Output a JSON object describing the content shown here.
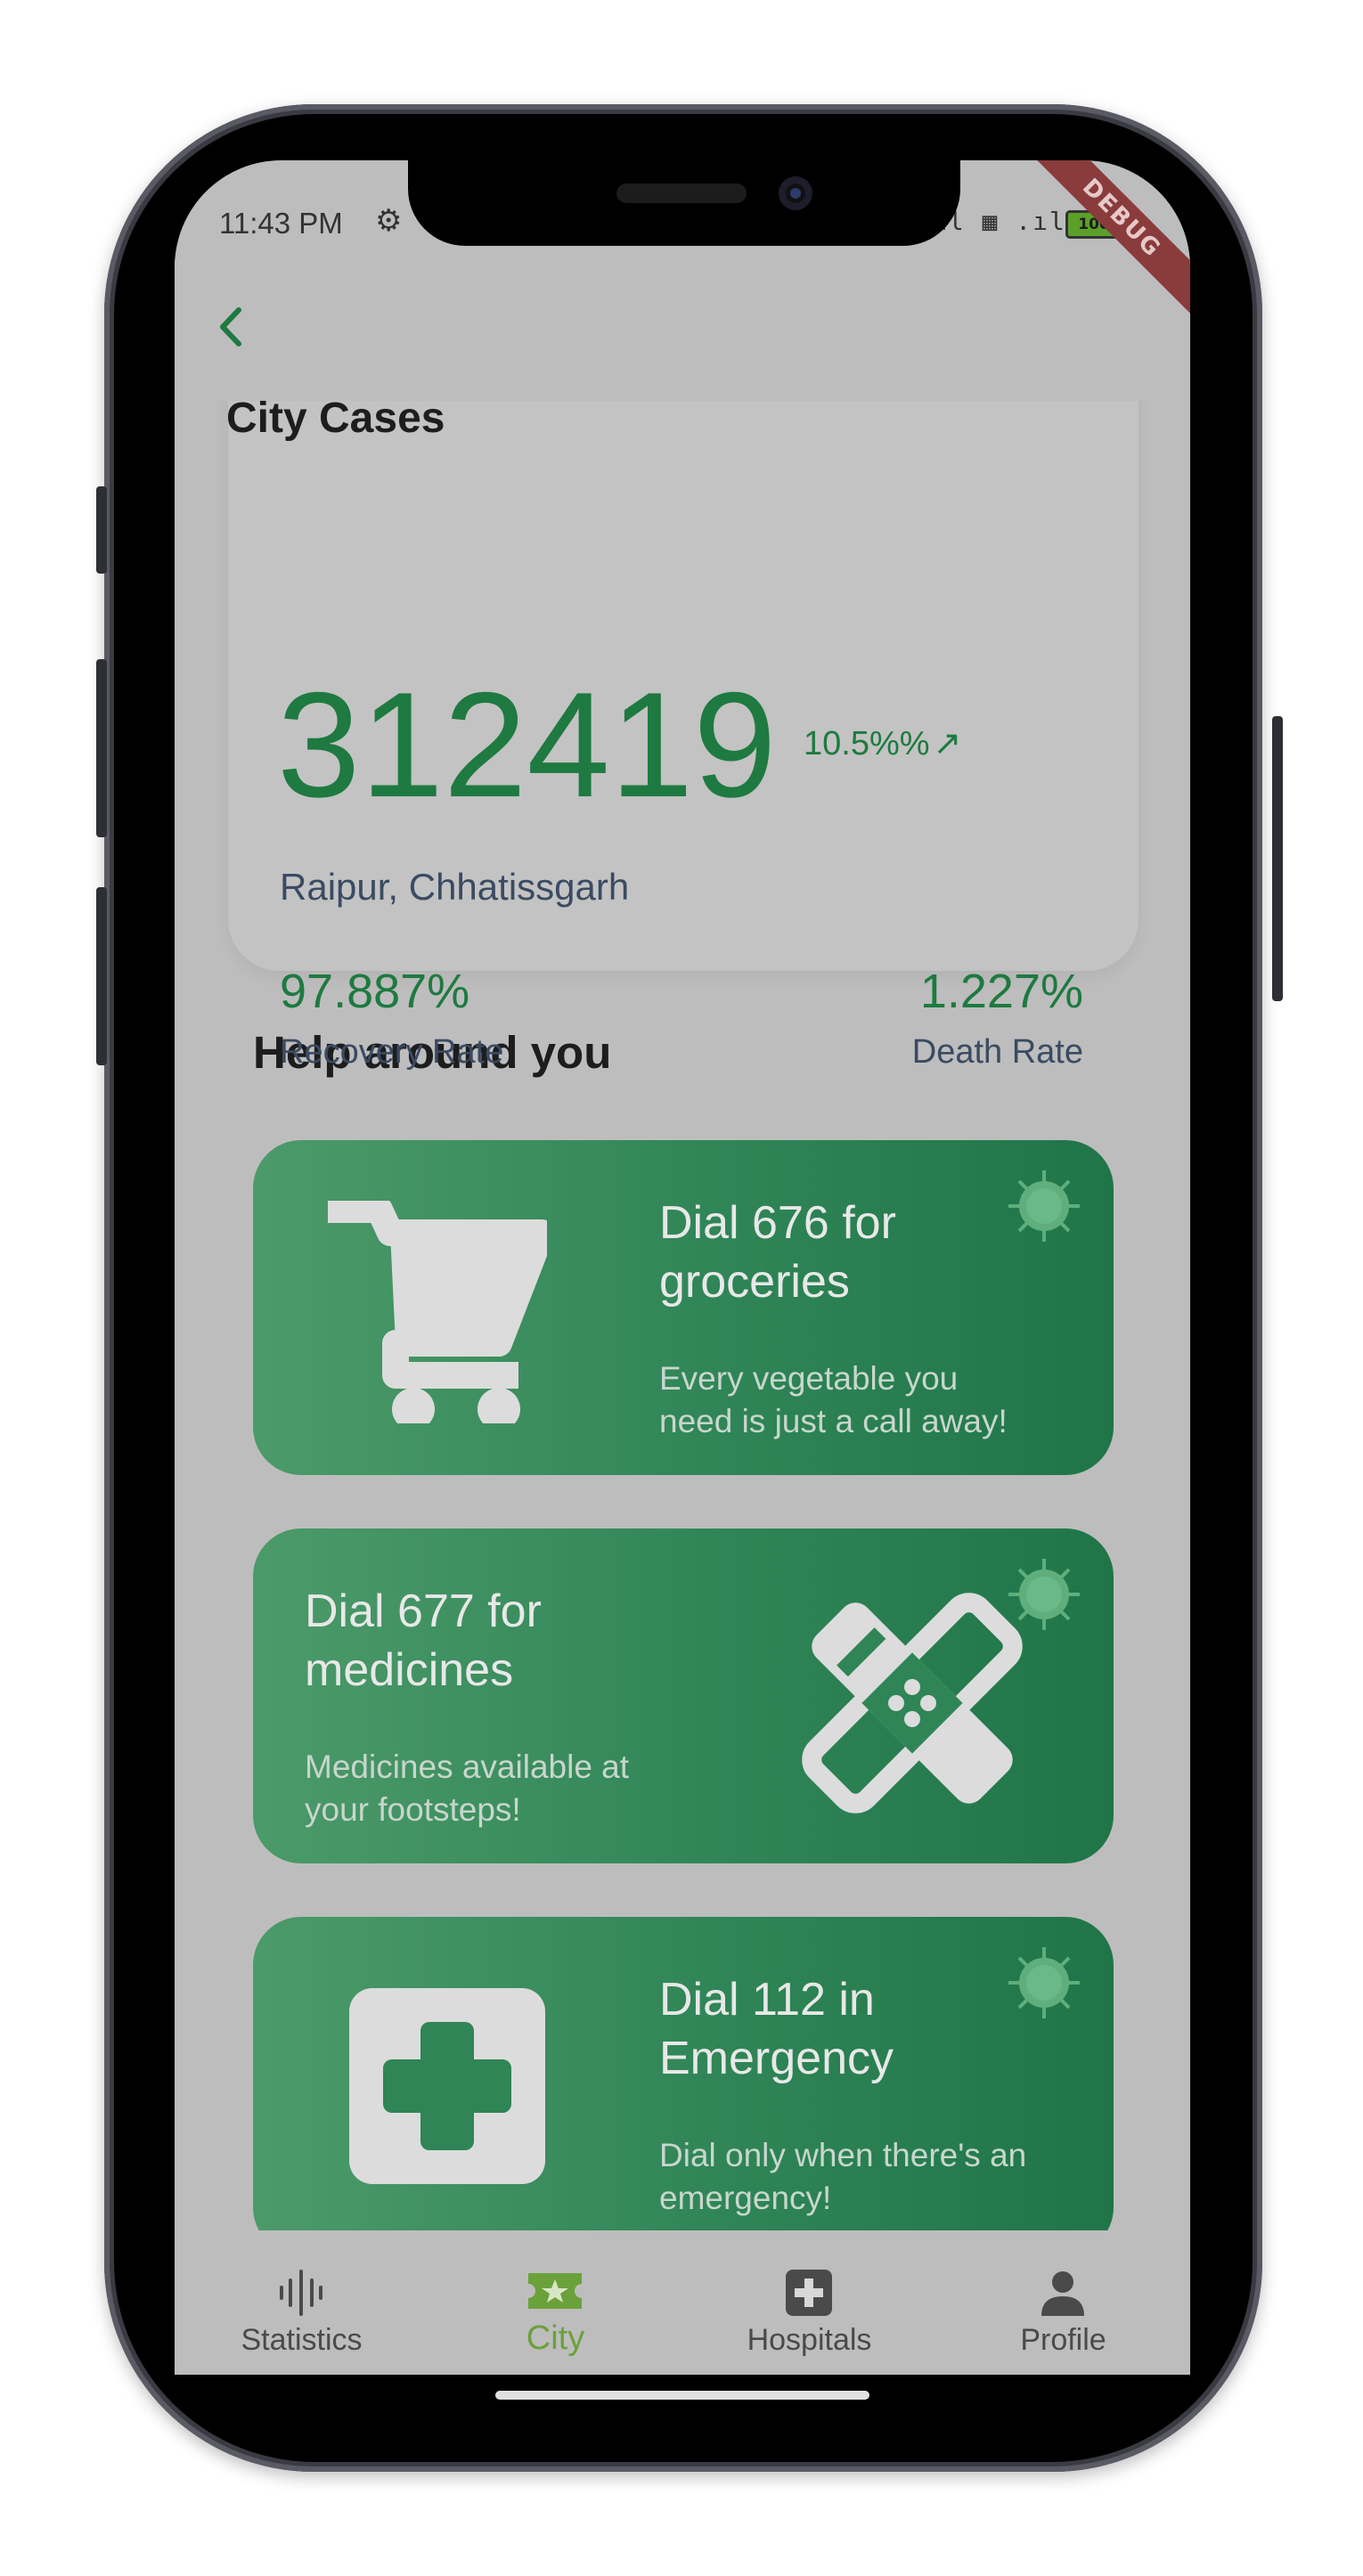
{
  "status_bar": {
    "time": "11:43 PM",
    "signal_text": "ıl ▦ .ıll",
    "battery": "100",
    "debug_label": "DEBUG"
  },
  "city_card": {
    "title": "City Cases",
    "cases": "312419",
    "growth": "10.5%%",
    "location": "Raipur, Chhatissgarh",
    "recovery_value": "97.887%",
    "recovery_label": "Recovery Rate",
    "death_value": "1.227%",
    "death_label": "Death Rate"
  },
  "help_section": {
    "title": "Help around you",
    "cards": [
      {
        "title_line1": "Dial 676 for",
        "title_line2": "groceries",
        "sub_line1": "Every vegetable you",
        "sub_line2": "need is just a call away!",
        "icon": "shopping-cart-icon"
      },
      {
        "title_line1": "Dial 677 for",
        "title_line2": "medicines",
        "sub_line1": "Medicines available at",
        "sub_line2": "your footsteps!",
        "icon": "bandage-icon"
      },
      {
        "title_line1": "Dial 112 in",
        "title_line2": "Emergency",
        "sub_line1": "Dial only when there's an",
        "sub_line2": "emergency!",
        "icon": "medical-cross-icon"
      }
    ]
  },
  "bottom_nav": {
    "items": [
      {
        "label": "Statistics",
        "icon": "waveform-icon"
      },
      {
        "label": "City",
        "icon": "city-star-icon",
        "active": true
      },
      {
        "label": "Hospitals",
        "icon": "hospital-icon"
      },
      {
        "label": "Profile",
        "icon": "person-icon"
      }
    ]
  },
  "colors": {
    "accent_green": "#1e7a40",
    "nav_active": "#6ba13a",
    "card_gradient_start": "#4c9a6a",
    "card_gradient_end": "#1f7548"
  }
}
